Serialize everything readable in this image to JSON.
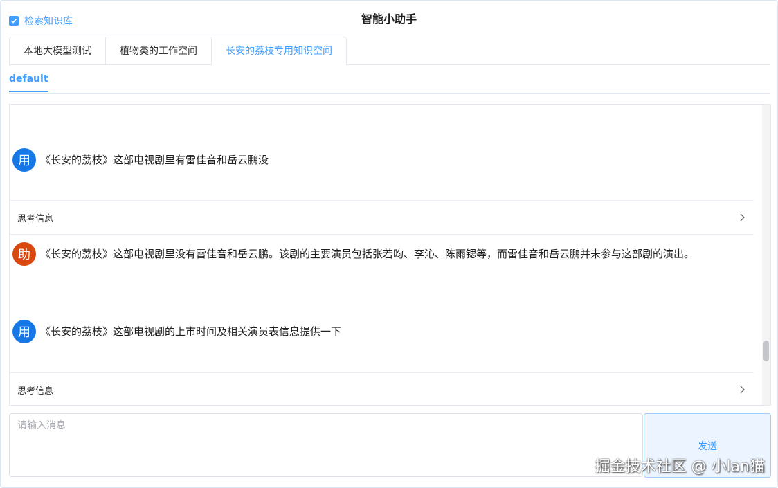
{
  "header": {
    "kb_toggle_label": "检索知识库",
    "kb_toggle_checked": true,
    "title": "智能小助手"
  },
  "tabs": [
    {
      "label": "本地大模型测试",
      "active": false
    },
    {
      "label": "植物类的工作空间",
      "active": false
    },
    {
      "label": "长安的荔枝专用知识空间",
      "active": true
    }
  ],
  "subtabs": [
    {
      "label": "default",
      "active": true
    }
  ],
  "messages": [
    {
      "role": "user",
      "avatar": "用",
      "text": "《长安的荔枝》这部电视剧里有雷佳音和岳云鹏没"
    },
    {
      "role": "think",
      "label": "思考信息",
      "icon": "chevron-right-icon"
    },
    {
      "role": "assistant",
      "avatar": "助",
      "text": "《长安的荔枝》这部电视剧里没有雷佳音和岳云鹏。该剧的主要演员包括张若昀、李沁、陈雨锶等，而雷佳音和岳云鹏并未参与这部剧的演出。"
    },
    {
      "role": "user",
      "avatar": "用",
      "text": "《长安的荔枝》这部电视剧的上市时间及相关演员表信息提供一下"
    },
    {
      "role": "think",
      "label": "思考信息",
      "icon": "chevron-right-icon"
    }
  ],
  "composer": {
    "placeholder": "请输入消息",
    "value": "",
    "send_label": "发送"
  },
  "watermark": "掘金技术社区 @ 小lan猫",
  "colors": {
    "accent": "#409eff",
    "user_avatar": "#1677e6",
    "assistant_avatar": "#d9480f"
  }
}
